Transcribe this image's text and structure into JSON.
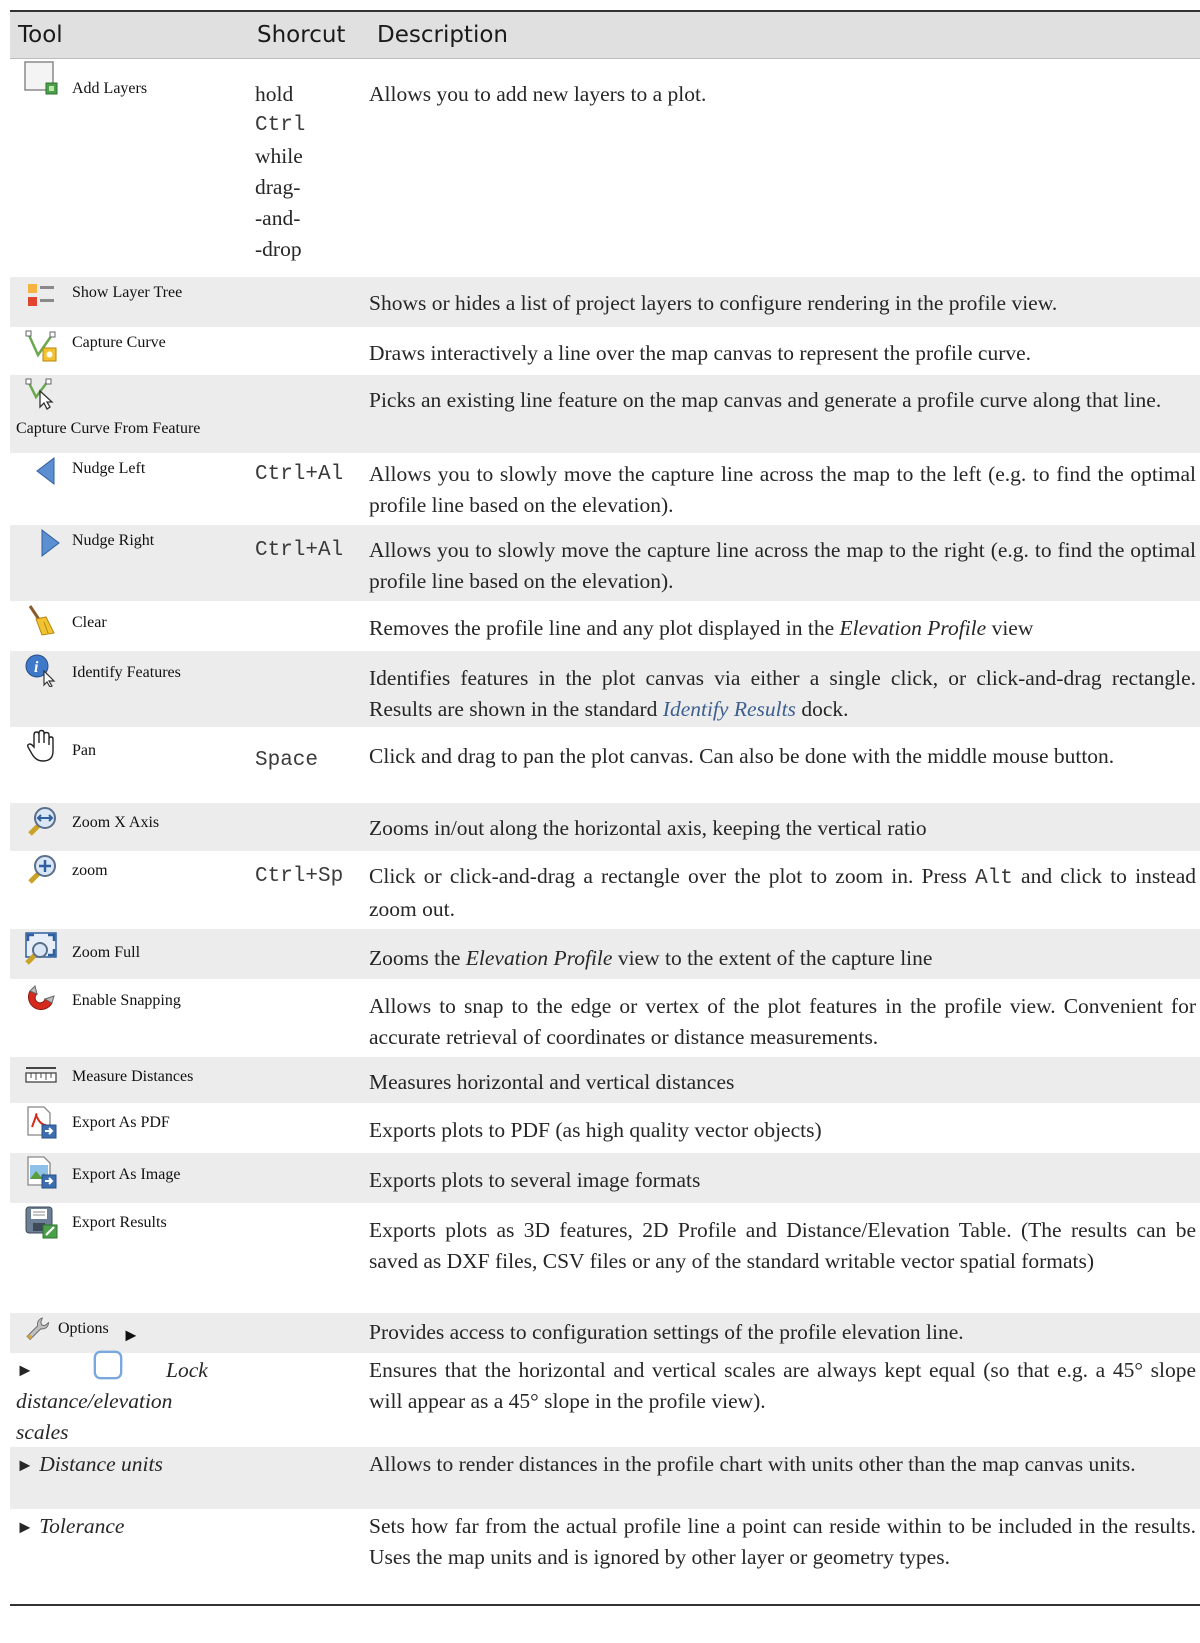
{
  "headers": {
    "tool": "Tool",
    "shortcut": "Shorcut",
    "description": "Description"
  },
  "rows": [
    {
      "icon": "add-layers-icon",
      "tool": "Add Layers",
      "shortcut_lines": [
        "hold",
        "Ctrl",
        "while",
        "drag-",
        "-and-",
        "-drop"
      ],
      "description": "Allows you to add new layers to a plot."
    },
    {
      "icon": "layer-tree-icon",
      "tool": "Show Layer Tree",
      "shortcut": "",
      "description": "Shows or hides a list of project layers to configure rendering in the profile view."
    },
    {
      "icon": "capture-curve-icon",
      "tool": "Capture Curve",
      "shortcut": "",
      "description": "Draws interactively a line over the map canvas to represent the profile curve."
    },
    {
      "icon": "capture-curve-from-feature-icon",
      "tool": "Capture Curve From Feature",
      "shortcut": "",
      "description": "Picks an existing line feature on the map canvas and generate a profile curve along that line."
    },
    {
      "icon": "nudge-left-icon",
      "tool": "Nudge Left",
      "shortcut": "Ctrl+Al",
      "description": "Allows you to slowly move the capture line across the map to the left (e.g. to find the optimal profile line based on the elevation)."
    },
    {
      "icon": "nudge-right-icon",
      "tool": "Nudge Right",
      "shortcut": "Ctrl+Al",
      "description": "Allows you to slowly move the capture line across the map to the right (e.g. to find the optimal profile line based on the elevation)."
    },
    {
      "icon": "clear-icon",
      "tool": "Clear",
      "shortcut": "",
      "description_pre": "Removes the profile line and any plot displayed in the ",
      "description_em": "Elevation Profile",
      "description_post": " view"
    },
    {
      "icon": "identify-features-icon",
      "tool": "Identify Features",
      "shortcut": "",
      "description_pre": "Identifies features in the plot canvas via either a single click, or click-and-drag rectangle. Results are shown in the standard ",
      "description_link": "Identify Results",
      "description_post": " dock."
    },
    {
      "icon": "pan-icon",
      "tool": "Pan",
      "shortcut": "Space",
      "description": "Click and drag to pan the plot canvas. Can also be done with the middle mouse button."
    },
    {
      "icon": "zoom-x-axis-icon",
      "tool": "Zoom X Axis",
      "shortcut": "",
      "description": "Zooms in/out along the horizontal axis, keeping the vertical ratio"
    },
    {
      "icon": "zoom-icon",
      "tool": "zoom",
      "shortcut": "Ctrl+Sp",
      "description_pre": "Click or click-and-drag a rectangle over the plot to zoom in. Press ",
      "description_code": "Alt",
      "description_post": " and click to instead zoom out."
    },
    {
      "icon": "zoom-full-icon",
      "tool": "Zoom Full",
      "shortcut": "",
      "description_pre": "Zooms the ",
      "description_em": "Elevation Profile",
      "description_post": " view to the extent of the capture line"
    },
    {
      "icon": "snapping-magnet-icon",
      "tool": "Enable Snapping",
      "shortcut": "",
      "description": "Allows to snap to the edge or vertex of the plot features in the profile view. Convenient for accurate retrieval of coordinates or distance measurements."
    },
    {
      "icon": "measure-ruler-icon",
      "tool": "Measure Distances",
      "shortcut": "",
      "description": "Measures horizontal and vertical distances"
    },
    {
      "icon": "export-pdf-icon",
      "tool": "Export As PDF",
      "shortcut": "",
      "description": "Exports plots to PDF (as high quality vector objects)"
    },
    {
      "icon": "export-image-icon",
      "tool": "Export As Image",
      "shortcut": "",
      "description": "Exports plots to several image formats"
    },
    {
      "icon": "export-results-icon",
      "tool": "Export Results",
      "shortcut": "",
      "description": "Exports plots as 3D features, 2D Profile and Distance/Elevation Table. (The results can be saved as DXF files, CSV files or any of the standard writable vector spatial formats)"
    },
    {
      "icon": "options-wrench-icon",
      "tool": "Options",
      "tool_suffix": "►",
      "shortcut": "",
      "description": "Provides access to configuration settings of the profile elevation line."
    },
    {
      "icon": "lock-checkbox-icon",
      "tool_prefix": "►",
      "tool": "Lock distance/elevation scales",
      "shortcut": "",
      "description": "Ensures that the horizontal and vertical scales are always kept equal (so that e.g. a 45° slope will appear as a 45° slope in the profile view)."
    },
    {
      "tool_prefix": "►",
      "tool": "Distance units",
      "shortcut": "",
      "description": "Allows to render distances in the profile chart with units other than the map canvas units."
    },
    {
      "tool_prefix": "►",
      "tool": "Tolerance",
      "shortcut": "",
      "description": "Sets how far from the actual profile line a point can reside within to be included in the results. Uses the map units and is ignored by other layer or geometry types."
    }
  ]
}
